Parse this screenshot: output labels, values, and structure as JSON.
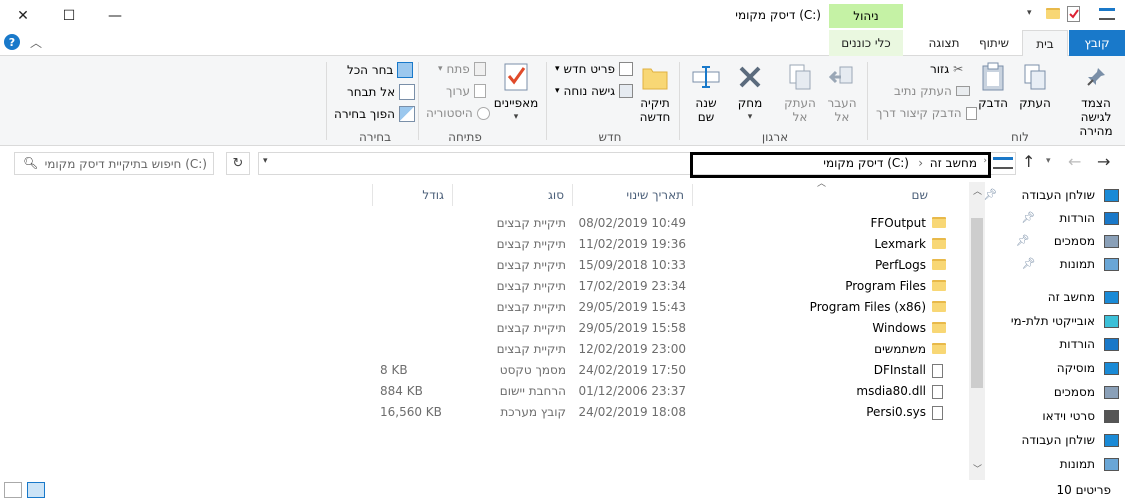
{
  "window": {
    "title": "דיסק מקומי (C:)",
    "manage_tab": "ניהול",
    "drive_tools_tab": "כלי כוננים"
  },
  "tabs": [
    "קובץ",
    "בית",
    "שיתוף",
    "תצוגה"
  ],
  "ribbon": {
    "clipboard": {
      "label": "לוח",
      "pin": "הצמד לגישה\nמהירה",
      "copy": "העתק",
      "paste": "הדבק",
      "cut": "גזור",
      "copy_path": "העתק נתיב",
      "paste_shortcut": "הדבק קיצור דרך"
    },
    "organize": {
      "label": "ארגון",
      "move_to": "העבר\nאל",
      "copy_to": "העתק\nאל",
      "delete": "מחק",
      "rename": "שנה\nשם"
    },
    "new": {
      "label": "חדש",
      "new_folder": "תיקיה\nחדשה",
      "new_item": "פריט חדש",
      "easy_access": "גישה נוחה"
    },
    "open": {
      "label": "פתיחה",
      "properties": "מאפיינים",
      "open": "פתח",
      "edit": "ערוך",
      "history": "היסטוריה"
    },
    "select": {
      "label": "בחירה",
      "select_all": "בחר הכל",
      "select_none": "אל תבחר",
      "invert": "הפוך בחירה"
    }
  },
  "address": {
    "parts": [
      "מחשב זה",
      "דיסק מקומי (C:)"
    ],
    "search_placeholder": "חיפוש בתיקיית דיסק מקומי (C:)"
  },
  "columns": {
    "name": "שם",
    "date": "תאריך שינוי",
    "type": "סוג",
    "size": "גודל"
  },
  "files": [
    {
      "name": "FFOutput",
      "date": "08/02/2019 10:49",
      "type": "תיקיית קבצים",
      "size": "",
      "kind": "folder"
    },
    {
      "name": "Lexmark",
      "date": "11/02/2019 19:36",
      "type": "תיקיית קבצים",
      "size": "",
      "kind": "folder"
    },
    {
      "name": "PerfLogs",
      "date": "15/09/2018 10:33",
      "type": "תיקיית קבצים",
      "size": "",
      "kind": "folder"
    },
    {
      "name": "Program Files",
      "date": "17/02/2019 23:34",
      "type": "תיקיית קבצים",
      "size": "",
      "kind": "folder"
    },
    {
      "name": "Program Files (x86)",
      "date": "29/05/2019 15:43",
      "type": "תיקיית קבצים",
      "size": "",
      "kind": "folder"
    },
    {
      "name": "Windows",
      "date": "29/05/2019 15:58",
      "type": "תיקיית קבצים",
      "size": "",
      "kind": "folder"
    },
    {
      "name": "משתמשים",
      "date": "12/02/2019 23:00",
      "type": "תיקיית קבצים",
      "size": "",
      "kind": "folder"
    },
    {
      "name": "DFInstall",
      "date": "24/02/2019 17:50",
      "type": "מסמך טקסט",
      "size": "8 KB",
      "kind": "file"
    },
    {
      "name": "msdia80.dll",
      "date": "01/12/2006 23:37",
      "type": "הרחבת יישום",
      "size": "884 KB",
      "kind": "file"
    },
    {
      "name": "Persi0.sys",
      "date": "24/02/2019 18:08",
      "type": "קובץ מערכת",
      "size": "16,560 KB",
      "kind": "file"
    }
  ],
  "navpane": [
    {
      "label": "שולחן העבודה",
      "icon": "desktop-icon",
      "pinned": true
    },
    {
      "label": "הורדות",
      "icon": "downloads-icon",
      "pinned": true
    },
    {
      "label": "מסמכים",
      "icon": "documents-icon",
      "pinned": true
    },
    {
      "label": "תמונות",
      "icon": "pictures-icon",
      "pinned": true
    },
    {
      "label": "מחשב זה",
      "icon": "computer-icon",
      "pinned": false
    },
    {
      "label": "אובייקטי תלת-מי",
      "icon": "3d-objects-icon",
      "pinned": false
    },
    {
      "label": "הורדות",
      "icon": "downloads-icon",
      "pinned": false
    },
    {
      "label": "מוסיקה",
      "icon": "music-icon",
      "pinned": false
    },
    {
      "label": "מסמכים",
      "icon": "documents-icon",
      "pinned": false
    },
    {
      "label": "סרטי וידאו",
      "icon": "videos-icon",
      "pinned": false
    },
    {
      "label": "שולחן העבודה",
      "icon": "desktop-icon",
      "pinned": false
    },
    {
      "label": "תמונות",
      "icon": "pictures-icon",
      "pinned": false
    }
  ],
  "status": {
    "count": "10 פריטים"
  },
  "colors": {
    "file_tab": "#1979ca",
    "manage_tab": "#c5f2a5",
    "accent": "#0063b1"
  }
}
